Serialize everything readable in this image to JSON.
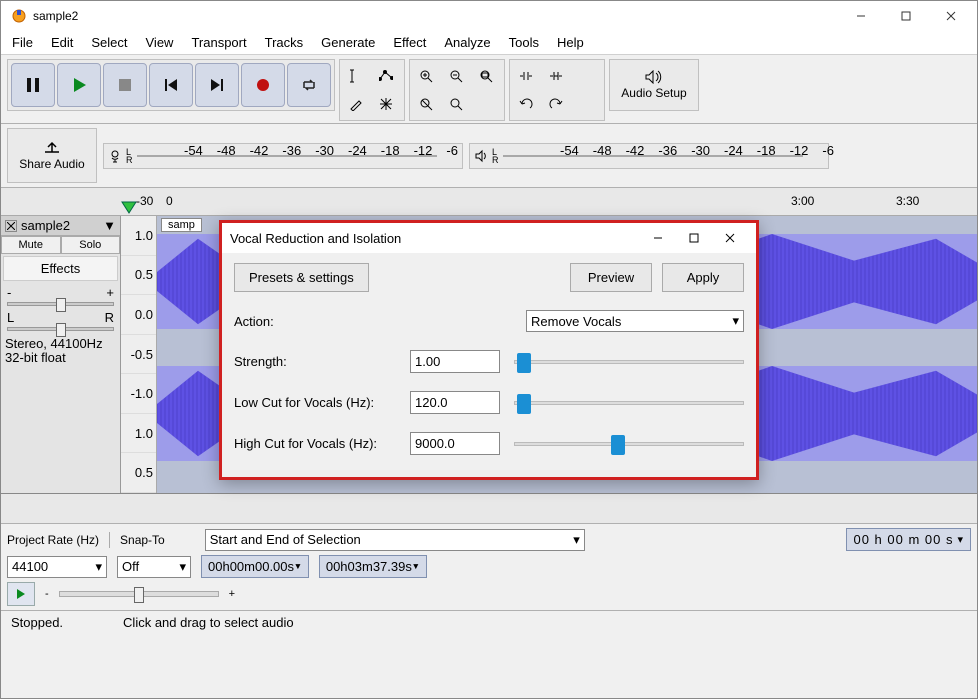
{
  "window": {
    "title": "sample2"
  },
  "menubar": [
    "File",
    "Edit",
    "Select",
    "View",
    "Transport",
    "Tracks",
    "Generate",
    "Effect",
    "Analyze",
    "Tools",
    "Help"
  ],
  "audio_setup_label": "Audio Setup",
  "share_audio_label": "Share Audio",
  "meter_ticks": [
    "-54",
    "-48",
    "-42",
    "-36",
    "-30",
    "-24",
    "-18",
    "-12",
    "-6"
  ],
  "timeline": {
    "start": "-30",
    "marks": [
      "0",
      "3:00",
      "3:30"
    ]
  },
  "track": {
    "name": "sample2",
    "clip_label": "samp",
    "mute": "Mute",
    "solo": "Solo",
    "effects": "Effects",
    "pan_left": "L",
    "pan_right": "R",
    "info_line1": "Stereo, 44100Hz",
    "info_line2": "32-bit float",
    "amp_labels": [
      "1.0",
      "0.5",
      "0.0",
      "-0.5",
      "-1.0",
      "1.0",
      "0.5"
    ]
  },
  "footer": {
    "project_rate_label": "Project Rate (Hz)",
    "project_rate_value": "44100",
    "snap_label": "Snap-To",
    "snap_value": "Off",
    "selection_heading": "Start and End of Selection",
    "sel_start": "00h00m00.00s",
    "sel_end": "00h03m37.39s",
    "big_time": "00 h 00 m 00 s"
  },
  "status": {
    "state": "Stopped.",
    "hint": "Click and drag to select audio"
  },
  "dialog": {
    "title": "Vocal Reduction and Isolation",
    "presets": "Presets & settings",
    "preview": "Preview",
    "apply": "Apply",
    "action_label": "Action:",
    "action_value": "Remove Vocals",
    "strength_label": "Strength:",
    "strength_value": "1.00",
    "lowcut_label": "Low Cut for Vocals (Hz):",
    "lowcut_value": "120.0",
    "highcut_label": "High Cut for Vocals (Hz):",
    "highcut_value": "9000.0"
  }
}
